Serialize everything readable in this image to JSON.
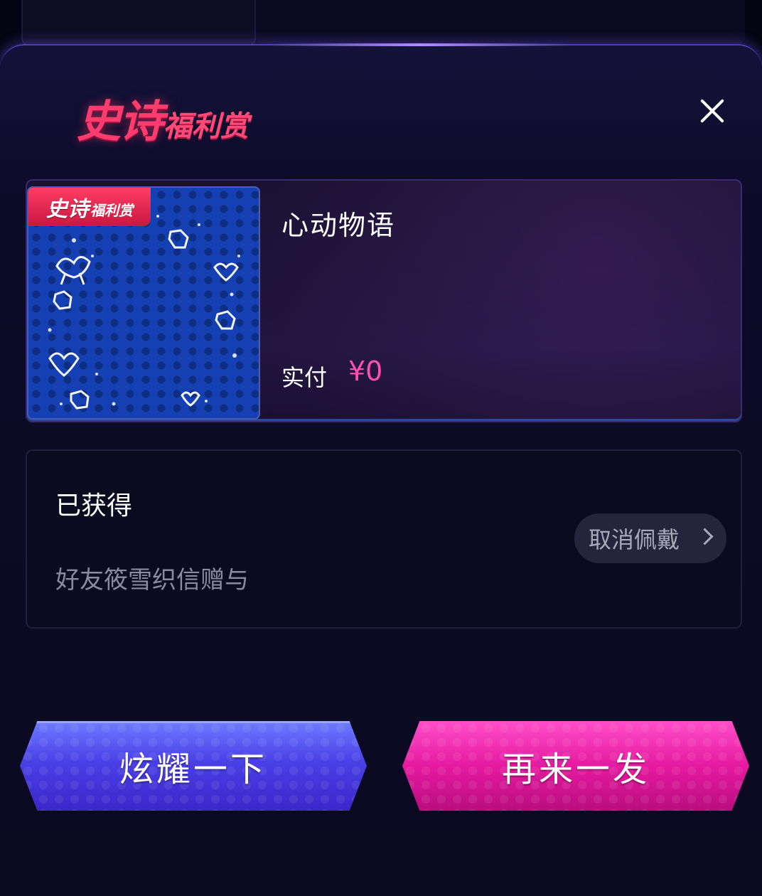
{
  "header": {
    "logo_main": "史诗",
    "logo_sub": "福利赏"
  },
  "prize": {
    "badge_main": "史诗",
    "badge_sub": "福利赏",
    "name": "心动物语",
    "pay_label": "实付",
    "pay_value": "¥0"
  },
  "obtained": {
    "title": "已获得",
    "source": "好友筱雪织信赠与",
    "unequip_label": "取消佩戴"
  },
  "actions": {
    "show_off_label": "炫耀一下",
    "again_label": "再来一发"
  },
  "colors": {
    "accent_pink": "#ff4fb1",
    "logo_red": "#ff3c6e",
    "button_blue": "#4a40e6",
    "button_magenta": "#e51aa0"
  },
  "icons": {
    "close": "close-icon",
    "chevron": "chevron-right-icon"
  }
}
